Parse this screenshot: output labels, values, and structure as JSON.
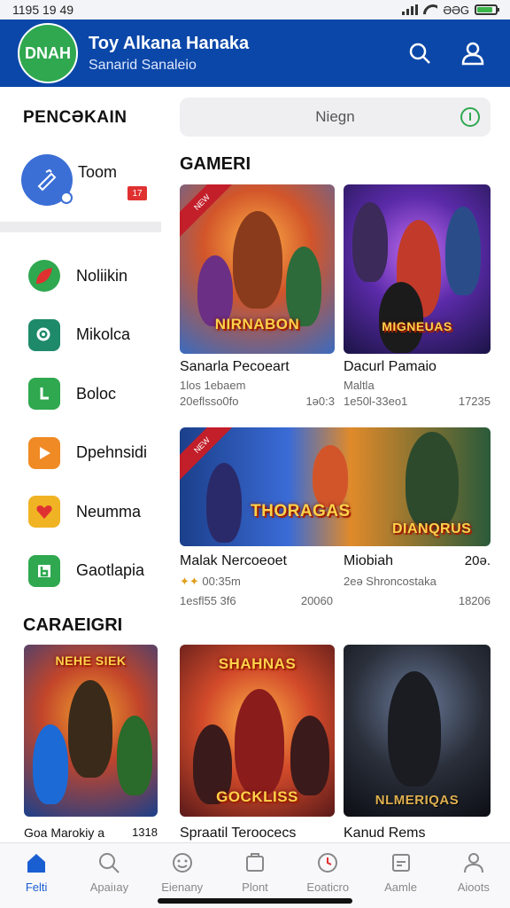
{
  "status_bar": {
    "time": "1195 19 49",
    "battery_text": "ƏƏG",
    "battery_level": 0.85
  },
  "header": {
    "logo_text": "DNAH",
    "title": "Toy Alkana Hanaka",
    "subtitle": "Sanarid Sanaleio",
    "icons": [
      "search-icon",
      "profile-icon"
    ]
  },
  "sidebar": {
    "title": "PENCƏKAIN",
    "profile": {
      "name": "Toom",
      "badge": "17"
    },
    "items": [
      {
        "label": "Noliikin",
        "icon": "leaf-icon",
        "color": "#2fa84f"
      },
      {
        "label": "Mikolca",
        "icon": "search-badge-icon",
        "color": "#1e8a6a"
      },
      {
        "label": "Boloc",
        "icon": "chat-icon",
        "color": "#2fa84f"
      },
      {
        "label": "Dpehnsidi",
        "icon": "play-icon",
        "color": "#f08a24"
      },
      {
        "label": "Neumma",
        "icon": "heart-icon",
        "color": "#f0b324"
      },
      {
        "label": "Gaotlapia",
        "icon": "book-icon",
        "color": "#2fa84f"
      }
    ]
  },
  "search": {
    "placeholder": "Niegn"
  },
  "sections": {
    "games": "GAMERI",
    "categories": "CARAEIGRI"
  },
  "game_cards": [
    {
      "art_title": "NIRNABON",
      "name": "Sanarla Pecoeart",
      "meta1": "1los 1ebaem",
      "meta2": "20eflsso0fo",
      "right": "1ə0:3"
    },
    {
      "art_title": "MIGNEUAS",
      "name": "Dacurl Pamaio",
      "meta1": "Maltla",
      "meta2": "1e50l-33eo1",
      "right": "17235"
    },
    {
      "art_title": "THORAGAS",
      "art_title2": "DIANQRUS",
      "name": "Malak Nercoeoet",
      "meta1": "00:35m",
      "meta2": "1esfl55 3f6",
      "right_mid": "20060"
    },
    {
      "name": "Miobiah",
      "meta1": "2eə Shroncostaka",
      "right_top": "20ə.",
      "right": "18206"
    }
  ],
  "category_cards": [
    {
      "art_title": "NEHE SIEK",
      "name": "Goa Marokiy a",
      "right": "1318"
    },
    {
      "art_title": "SHAHNAS",
      "name": "Spraatil Teroocecs",
      "bottom_art": "GOCKLISS"
    },
    {
      "art_title": "NLMERIQAS",
      "name": "Kanud Rems"
    }
  ],
  "bottom_nav": [
    {
      "label": "Felti",
      "icon": "home-icon",
      "active": true
    },
    {
      "label": "Apaiıay",
      "icon": "search-icon",
      "active": false
    },
    {
      "label": "Eienany",
      "icon": "smile-icon",
      "active": false
    },
    {
      "label": "Plont",
      "icon": "puzzle-icon",
      "active": false
    },
    {
      "label": "Eoaticro",
      "icon": "clock-icon",
      "active": false
    },
    {
      "label": "Aamle",
      "icon": "edit-icon",
      "active": false
    },
    {
      "label": "Aioots",
      "icon": "person-icon",
      "active": false
    }
  ]
}
